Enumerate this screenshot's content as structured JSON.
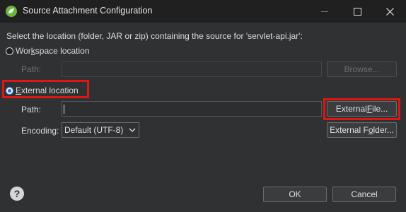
{
  "window": {
    "title": "Source Attachment Configuration"
  },
  "dialog": {
    "description": "Select the location (folder, JAR or zip) containing the source for 'servlet-api.jar':",
    "workspace": {
      "label_pre": "Wor",
      "label_mnemonic": "k",
      "label_post": "space location",
      "selected": false,
      "path_label": "Path:",
      "path_value": "",
      "browse_label": "Browse..."
    },
    "external": {
      "label_mnemonic": "E",
      "label_post": "xternal location",
      "selected": true,
      "path_label": "Path:",
      "path_value": "",
      "external_file_pre": "External ",
      "external_file_mnemonic": "F",
      "external_file_post": "ile...",
      "encoding_label": "Encoding:",
      "encoding_value": "Default (UTF-8)",
      "external_folder_pre": "External F",
      "external_folder_mnemonic": "o",
      "external_folder_post": "lder..."
    },
    "ok_label": "OK",
    "cancel_label": "Cancel",
    "help_glyph": "?"
  },
  "colors": {
    "highlight": "#e01515",
    "background": "#2f3133",
    "titlebar": "#202020"
  }
}
